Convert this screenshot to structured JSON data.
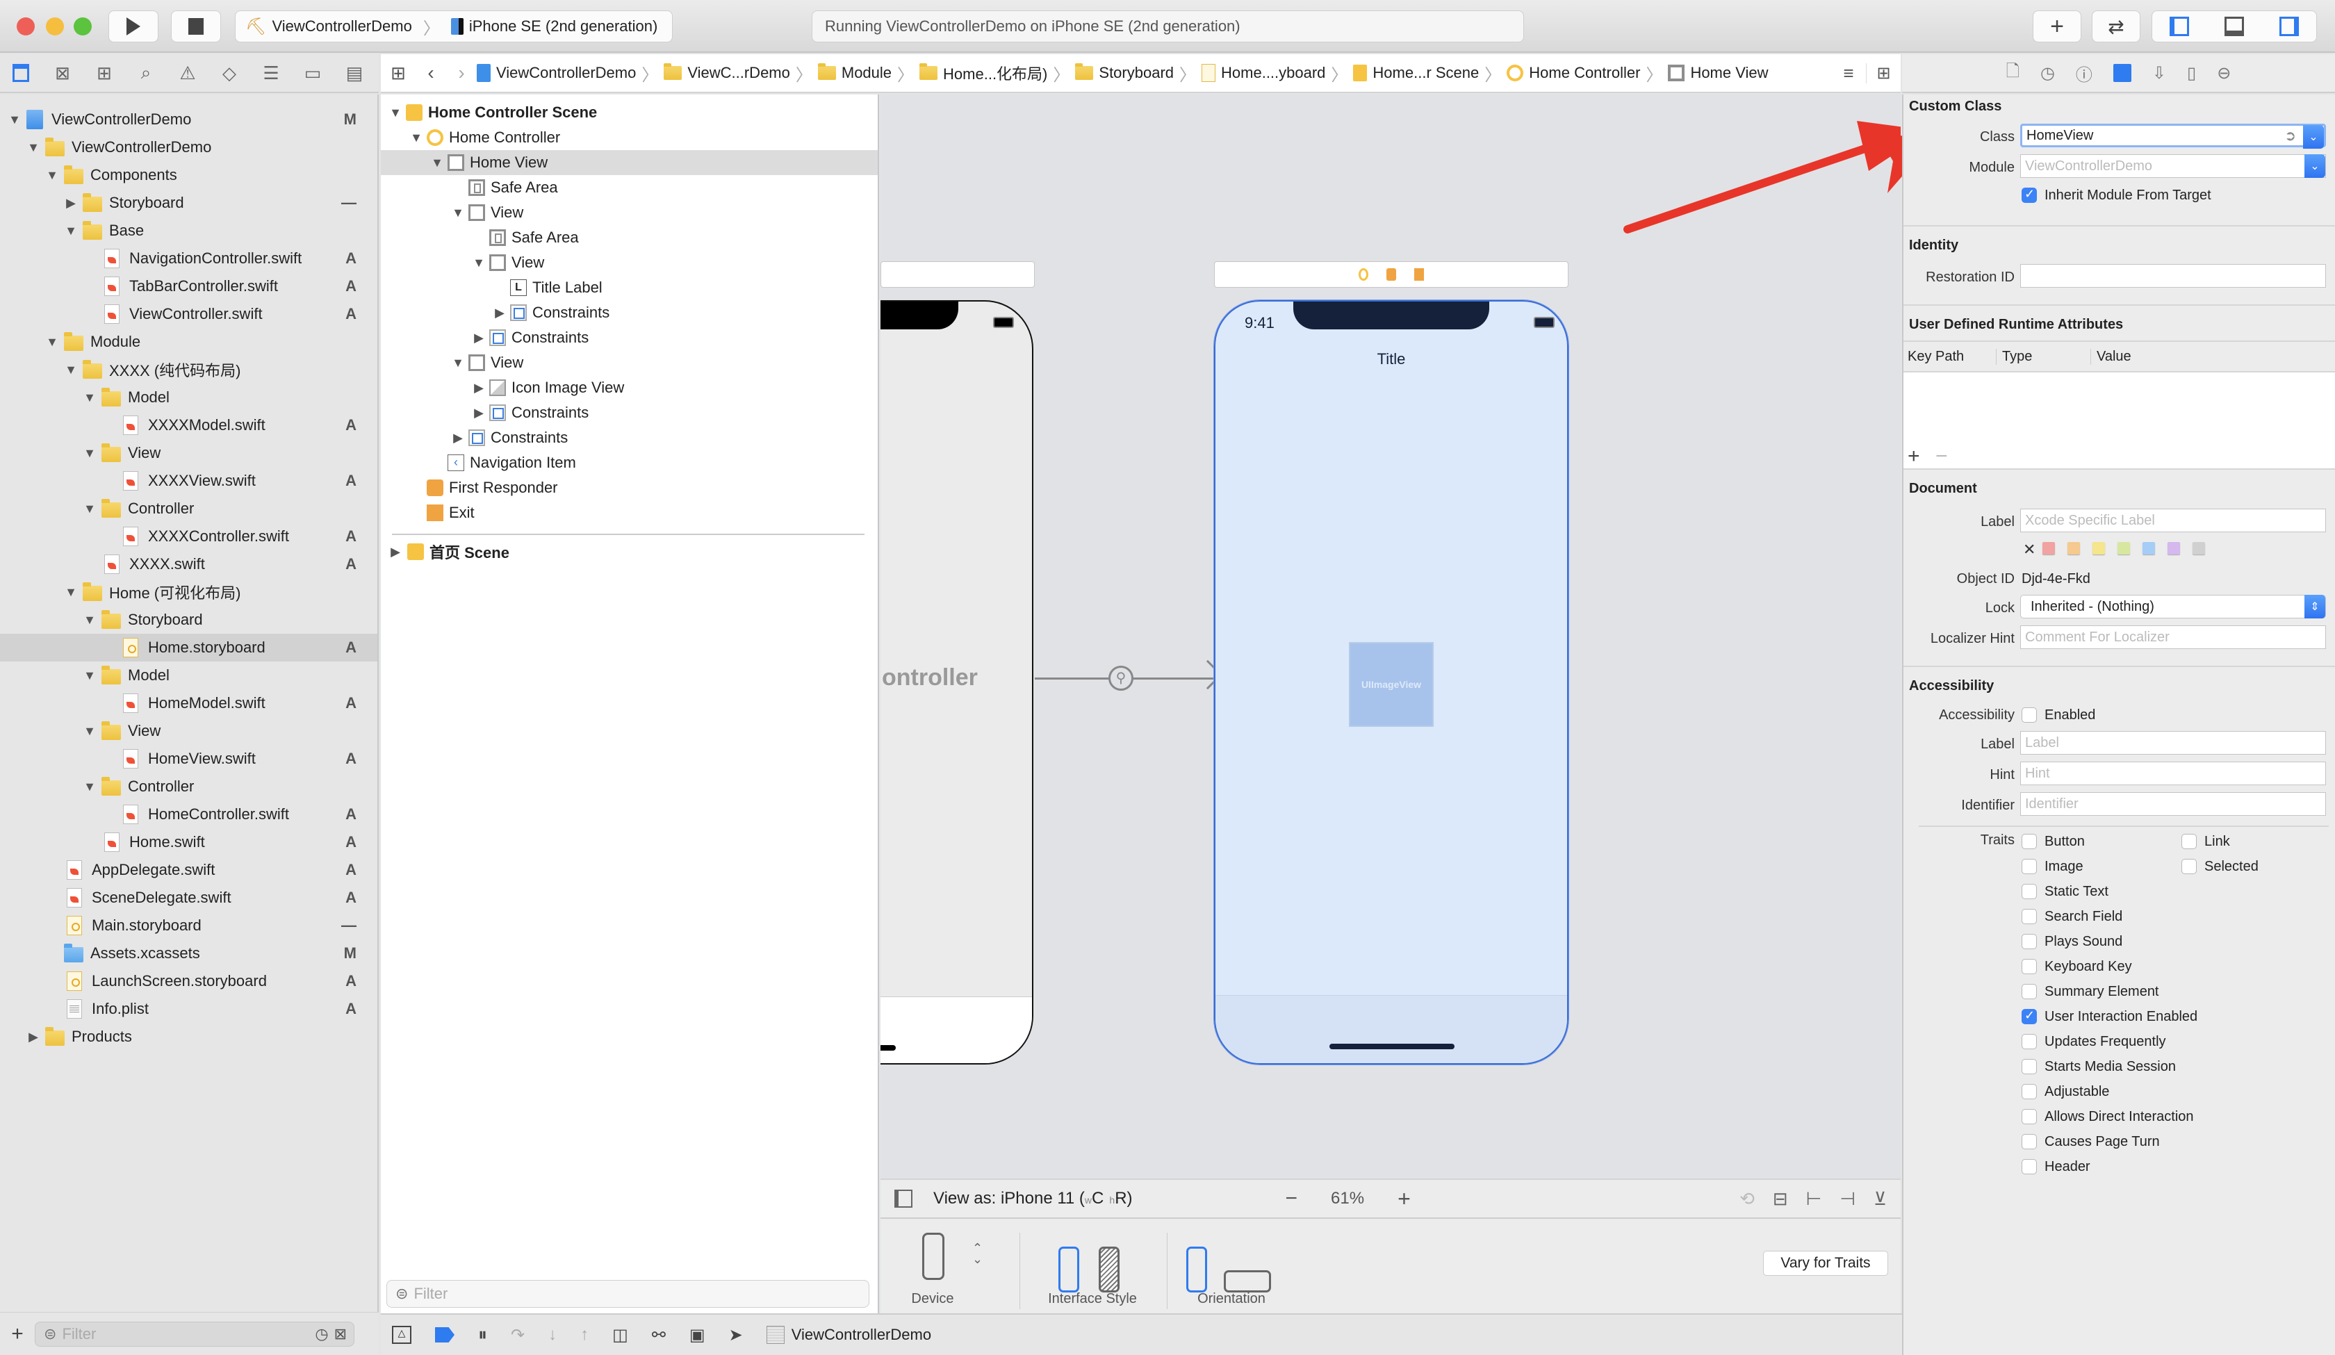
{
  "window": {
    "scheme_project": "ViewControllerDemo",
    "scheme_device": "iPhone SE (2nd generation)",
    "status": "Running ViewControllerDemo on iPhone SE (2nd generation)"
  },
  "jumpbar": {
    "crumbs": [
      "ViewControllerDemo",
      "ViewC...rDemo",
      "Module",
      "Home...化布局)",
      "Storyboard",
      "Home....yboard",
      "Home...r Scene",
      "Home Controller",
      "Home View"
    ]
  },
  "navigator": {
    "items": [
      {
        "label": "ViewControllerDemo",
        "kind": "project",
        "depth": 0,
        "open": true,
        "badge": "M"
      },
      {
        "label": "ViewControllerDemo",
        "kind": "folder",
        "depth": 1,
        "open": true,
        "badge": ""
      },
      {
        "label": "Components",
        "kind": "folder",
        "depth": 2,
        "open": true,
        "badge": ""
      },
      {
        "label": "Storyboard",
        "kind": "folder",
        "depth": 3,
        "open": false,
        "badge": "—"
      },
      {
        "label": "Base",
        "kind": "folder",
        "depth": 3,
        "open": true,
        "badge": ""
      },
      {
        "label": "NavigationController.swift",
        "kind": "swift",
        "depth": 4,
        "badge": "A"
      },
      {
        "label": "TabBarController.swift",
        "kind": "swift",
        "depth": 4,
        "badge": "A"
      },
      {
        "label": "ViewController.swift",
        "kind": "swift",
        "depth": 4,
        "badge": "A"
      },
      {
        "label": "Module",
        "kind": "folder",
        "depth": 2,
        "open": true,
        "badge": ""
      },
      {
        "label": "XXXX (纯代码布局)",
        "kind": "folder",
        "depth": 3,
        "open": true,
        "badge": ""
      },
      {
        "label": "Model",
        "kind": "folder",
        "depth": 4,
        "open": true,
        "badge": ""
      },
      {
        "label": "XXXXModel.swift",
        "kind": "swift",
        "depth": 5,
        "badge": "A"
      },
      {
        "label": "View",
        "kind": "folder",
        "depth": 4,
        "open": true,
        "badge": ""
      },
      {
        "label": "XXXXView.swift",
        "kind": "swift",
        "depth": 5,
        "badge": "A"
      },
      {
        "label": "Controller",
        "kind": "folder",
        "depth": 4,
        "open": true,
        "badge": ""
      },
      {
        "label": "XXXXController.swift",
        "kind": "swift",
        "depth": 5,
        "badge": "A"
      },
      {
        "label": "XXXX.swift",
        "kind": "swift",
        "depth": 4,
        "badge": "A"
      },
      {
        "label": "Home (可视化布局)",
        "kind": "folder",
        "depth": 3,
        "open": true,
        "badge": ""
      },
      {
        "label": "Storyboard",
        "kind": "folder",
        "depth": 4,
        "open": true,
        "badge": ""
      },
      {
        "label": "Home.storyboard",
        "kind": "storyboard",
        "depth": 5,
        "badge": "A",
        "selected": true
      },
      {
        "label": "Model",
        "kind": "folder",
        "depth": 4,
        "open": true,
        "badge": ""
      },
      {
        "label": "HomeModel.swift",
        "kind": "swift",
        "depth": 5,
        "badge": "A"
      },
      {
        "label": "View",
        "kind": "folder",
        "depth": 4,
        "open": true,
        "badge": ""
      },
      {
        "label": "HomeView.swift",
        "kind": "swift",
        "depth": 5,
        "badge": "A"
      },
      {
        "label": "Controller",
        "kind": "folder",
        "depth": 4,
        "open": true,
        "badge": ""
      },
      {
        "label": "HomeController.swift",
        "kind": "swift",
        "depth": 5,
        "badge": "A"
      },
      {
        "label": "Home.swift",
        "kind": "swift",
        "depth": 4,
        "badge": "A"
      },
      {
        "label": "AppDelegate.swift",
        "kind": "swift",
        "depth": 2,
        "badge": "A"
      },
      {
        "label": "SceneDelegate.swift",
        "kind": "swift",
        "depth": 2,
        "badge": "A"
      },
      {
        "label": "Main.storyboard",
        "kind": "storyboard",
        "depth": 2,
        "badge": "—"
      },
      {
        "label": "Assets.xcassets",
        "kind": "assets",
        "depth": 2,
        "badge": "M"
      },
      {
        "label": "LaunchScreen.storyboard",
        "kind": "storyboard",
        "depth": 2,
        "badge": "A"
      },
      {
        "label": "Info.plist",
        "kind": "plist",
        "depth": 2,
        "badge": "A"
      },
      {
        "label": "Products",
        "kind": "folder",
        "depth": 1,
        "open": false,
        "badge": ""
      }
    ],
    "filter_placeholder": "Filter"
  },
  "outline": {
    "items": [
      {
        "label": "Home Controller Scene",
        "icon": "scene",
        "depth": 0,
        "tri": "open",
        "bold": true
      },
      {
        "label": "Home Controller",
        "icon": "ctrl",
        "depth": 1,
        "tri": "open"
      },
      {
        "label": "Home View",
        "icon": "view",
        "depth": 2,
        "tri": "open",
        "selected": true
      },
      {
        "label": "Safe Area",
        "icon": "safe",
        "depth": 3,
        "tri": ""
      },
      {
        "label": "View",
        "icon": "view",
        "depth": 3,
        "tri": "open"
      },
      {
        "label": "Safe Area",
        "icon": "safe",
        "depth": 4,
        "tri": ""
      },
      {
        "label": "View",
        "icon": "view",
        "depth": 4,
        "tri": "open"
      },
      {
        "label": "Title Label",
        "icon": "label",
        "depth": 5,
        "tri": ""
      },
      {
        "label": "Constraints",
        "icon": "cons",
        "depth": 5,
        "tri": "closed"
      },
      {
        "label": "Constraints",
        "icon": "cons",
        "depth": 4,
        "tri": "closed"
      },
      {
        "label": "View",
        "icon": "view",
        "depth": 3,
        "tri": "open"
      },
      {
        "label": "Icon Image View",
        "icon": "img",
        "depth": 4,
        "tri": "closed"
      },
      {
        "label": "Constraints",
        "icon": "cons",
        "depth": 4,
        "tri": "closed"
      },
      {
        "label": "Constraints",
        "icon": "cons",
        "depth": 3,
        "tri": "closed"
      },
      {
        "label": "Navigation Item",
        "icon": "nav",
        "depth": 2,
        "tri": ""
      },
      {
        "label": "First Responder",
        "icon": "resp",
        "depth": 1,
        "tri": ""
      },
      {
        "label": "Exit",
        "icon": "exit",
        "depth": 1,
        "tri": ""
      }
    ],
    "scene2": "首页 Scene",
    "filter_placeholder": "Filter"
  },
  "canvas": {
    "left_scene_text": "ontroller",
    "status_time": "9:41",
    "title_label": "Title",
    "image_view_label": "UIImageView",
    "view_as": "View as: iPhone 11 (",
    "size_class_w": "w",
    "size_class_c": "C",
    "size_class_h": "h",
    "size_class_r": "R)",
    "zoom_level": "61%",
    "device_label": "Device",
    "interface_style_label": "Interface Style",
    "orientation_label": "Orientation",
    "vary_button": "Vary for Traits"
  },
  "bottombar": {
    "target": "ViewControllerDemo"
  },
  "inspector": {
    "custom_class": {
      "title": "Custom Class",
      "class_label": "Class",
      "class_value": "HomeView",
      "module_label": "Module",
      "module_placeholder": "ViewControllerDemo",
      "inherit_label": "Inherit Module From Target",
      "inherit_checked": true
    },
    "identity": {
      "title": "Identity",
      "restoration_label": "Restoration ID",
      "restoration_value": ""
    },
    "runtime": {
      "title": "User Defined Runtime Attributes",
      "columns": [
        "Key Path",
        "Type",
        "Value"
      ]
    },
    "document": {
      "title": "Document",
      "label_label": "Label",
      "label_placeholder": "Xcode Specific Label",
      "colors": [
        "#f0a3a0",
        "#f5c98f",
        "#f5e58b",
        "#d7e7a0",
        "#a6cdf5",
        "#d4b8ee",
        "#d0d0d0"
      ],
      "object_id_label": "Object ID",
      "object_id": "Djd-4e-Fkd",
      "lock_label": "Lock",
      "lock_value": "Inherited - (Nothing)",
      "localizer_label": "Localizer Hint",
      "localizer_placeholder": "Comment For Localizer"
    },
    "accessibility": {
      "title": "Accessibility",
      "acc_label": "Accessibility",
      "enabled_label": "Enabled",
      "enabled": false,
      "label_label": "Label",
      "label_placeholder": "Label",
      "hint_label": "Hint",
      "hint_placeholder": "Hint",
      "identifier_label": "Identifier",
      "identifier_placeholder": "Identifier",
      "traits_label": "Traits",
      "traits": [
        {
          "label": "Button",
          "checked": false
        },
        {
          "label": "Image",
          "checked": false
        },
        {
          "label": "Static Text",
          "checked": false
        },
        {
          "label": "Search Field",
          "checked": false
        },
        {
          "label": "Plays Sound",
          "checked": false
        },
        {
          "label": "Keyboard Key",
          "checked": false
        },
        {
          "label": "Summary Element",
          "checked": false
        },
        {
          "label": "User Interaction Enabled",
          "checked": true
        },
        {
          "label": "Updates Frequently",
          "checked": false
        },
        {
          "label": "Starts Media Session",
          "checked": false
        },
        {
          "label": "Adjustable",
          "checked": false
        },
        {
          "label": "Allows Direct Interaction",
          "checked": false
        },
        {
          "label": "Causes Page Turn",
          "checked": false
        },
        {
          "label": "Header",
          "checked": false
        }
      ],
      "traits_right": [
        {
          "label": "Link",
          "checked": false
        },
        {
          "label": "Selected",
          "checked": false
        }
      ]
    }
  },
  "colors": {
    "accent": "#3b82f6",
    "annotation_arrow": "#e8352a",
    "canvas_bg": "#e1e2e5",
    "selected_view": "#dce9fb"
  }
}
